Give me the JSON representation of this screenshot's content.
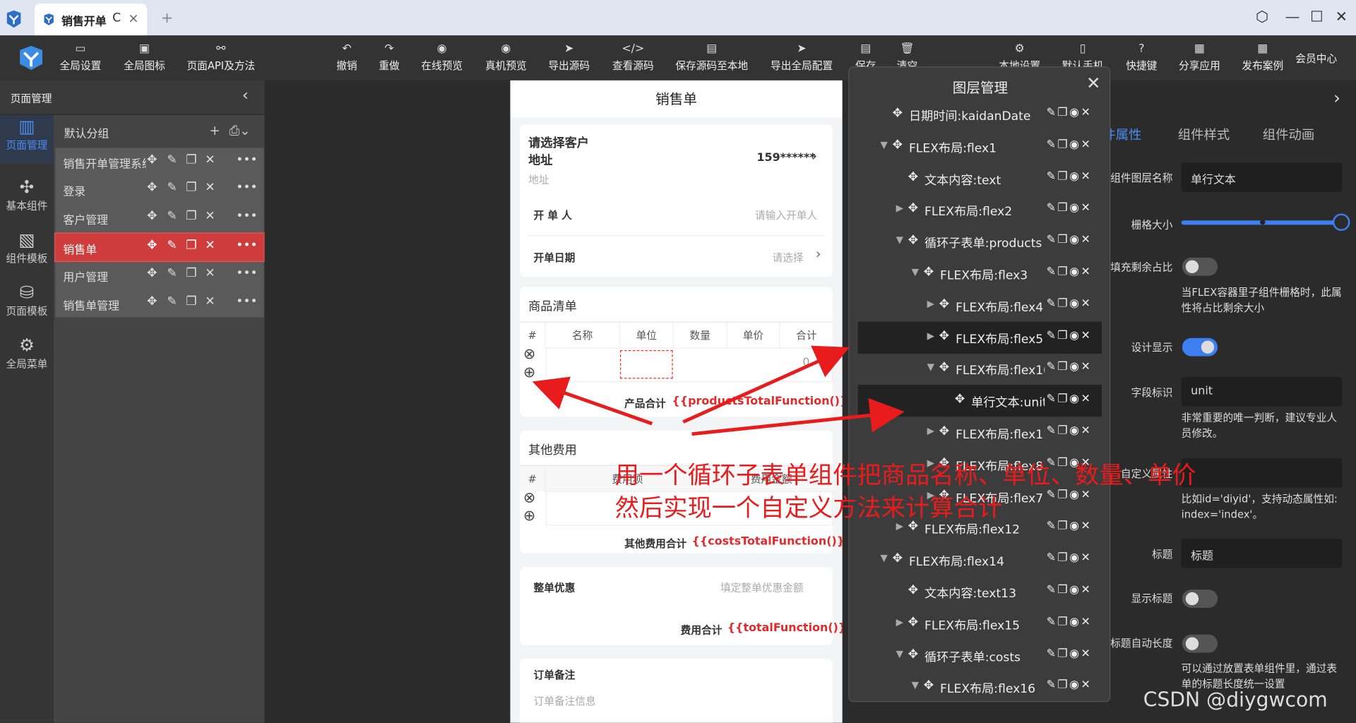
{
  "browser": {
    "tab_title": "销售开单",
    "refresh": "C",
    "close": "×",
    "new_tab": "+"
  },
  "toolbar": {
    "items": [
      "全局设置",
      "全局图标",
      "页面API及方法",
      "撤销",
      "重做",
      "在线预览",
      "真机预览",
      "导出源码",
      "查看源码",
      "保存源码至本地",
      "导出全局配置",
      "保存",
      "清空",
      "本地设置",
      "默认手机",
      "快捷键",
      "分享应用",
      "发布案例",
      "会员中心"
    ]
  },
  "left": {
    "title": "页面管理",
    "nav": [
      "页面管理",
      "基本组件",
      "组件模板",
      "页面模板",
      "全局菜单"
    ],
    "group": "默认分组",
    "pages": [
      "销售开单管理系统",
      "登录",
      "客户管理",
      "销售单",
      "用户管理",
      "销售单管理"
    ],
    "active_page": 3
  },
  "phone": {
    "title": "销售单",
    "customer": "请选择客户",
    "address_label": "地址",
    "phone_masked": "159******",
    "address_placeholder": "地址",
    "creator_label": "开 单 人",
    "creator_placeholder": "请输入开单人",
    "date_label": "开单日期",
    "date_placeholder": "请选择",
    "goods_title": "商品清单",
    "goods_cols": [
      "#",
      "名称",
      "单位",
      "数量",
      "单价",
      "合计"
    ],
    "goods_zero": "0",
    "goods_total_label": "产品合计",
    "goods_total_expr": "{{productsTotalFunction()}}",
    "other_title": "其他费用",
    "other_cols": [
      "#",
      "费用项",
      "费用金额"
    ],
    "other_total_label": "其他费用合计",
    "other_total_expr": "{{costsTotalFunction()}}",
    "discount_label": "整单优惠",
    "discount_placeholder": "填定整单优惠金额",
    "fee_total_label": "费用合计",
    "fee_total_expr": "{{totalFunction()}}",
    "remark_label": "订单备注",
    "remark_placeholder": "订单备注信息"
  },
  "layers": {
    "title": "图层管理",
    "rows": [
      {
        "name": "日期时间:kaidanDate",
        "indent": 0,
        "arrow": ""
      },
      {
        "name": "FLEX布局:flex1",
        "indent": 0,
        "arrow": "▼"
      },
      {
        "name": "文本内容:text",
        "indent": 1,
        "arrow": ""
      },
      {
        "name": "FLEX布局:flex2",
        "indent": 1,
        "arrow": "▶"
      },
      {
        "name": "循环子表单:products",
        "indent": 1,
        "arrow": "▼"
      },
      {
        "name": "FLEX布局:flex3",
        "indent": 2,
        "arrow": "▼"
      },
      {
        "name": "FLEX布局:flex4",
        "indent": 3,
        "arrow": "▶"
      },
      {
        "name": "FLEX布局:flex5",
        "indent": 3,
        "arrow": "▶"
      },
      {
        "name": "FLEX布局:flex10",
        "indent": 3,
        "arrow": "▼"
      },
      {
        "name": "单行文本:unit",
        "indent": 4,
        "arrow": ""
      },
      {
        "name": "FLEX布局:flex11",
        "indent": 3,
        "arrow": "▶"
      },
      {
        "name": "FLEX布局:flex8",
        "indent": 3,
        "arrow": "▶"
      },
      {
        "name": "FLEX布局:flex7",
        "indent": 3,
        "arrow": "▶"
      },
      {
        "name": "FLEX布局:flex12",
        "indent": 1,
        "arrow": "▶"
      },
      {
        "name": "FLEX布局:flex14",
        "indent": 0,
        "arrow": "▼"
      },
      {
        "name": "文本内容:text13",
        "indent": 1,
        "arrow": ""
      },
      {
        "name": "FLEX布局:flex15",
        "indent": 1,
        "arrow": "▶"
      },
      {
        "name": "循环子表单:costs",
        "indent": 1,
        "arrow": "▼"
      },
      {
        "name": "FLEX布局:flex16",
        "indent": 2,
        "arrow": "▼"
      }
    ],
    "selected_rows": [
      7,
      9
    ]
  },
  "right": {
    "tabs": [
      "组件属性",
      "组件样式",
      "组件动画"
    ],
    "layer_name_label": "组件图层名称",
    "layer_name_value": "单行文本",
    "grid_label": "栅格大小",
    "grid_value": 24,
    "fill_label": "填充剩余占比",
    "fill_desc": "当FLEX容器里子组件栅格时，此属性将占比剩余大小",
    "design_label": "设计显示",
    "field_label": "字段标识",
    "field_value": "unit",
    "field_desc": "非常重要的唯一判断，建议专业人员修改。",
    "custom_label": "自定义属性",
    "custom_desc": "比如id='diyid'，支持动态属性如: index='index'。",
    "title_label": "标题",
    "title_value": "标题",
    "show_title_label": "显示标题",
    "auto_len_label": "标题自动长度",
    "auto_len_desc": "可以通过放置表单组件里，通过表单的标题长度统一设置"
  },
  "annotation": {
    "line1": "用一个循环子表单组件把商品名称、单位、数量、单价",
    "line2": "然后实现一个自定义方法来计算合计"
  },
  "watermark": "CSDN @diygwcom"
}
